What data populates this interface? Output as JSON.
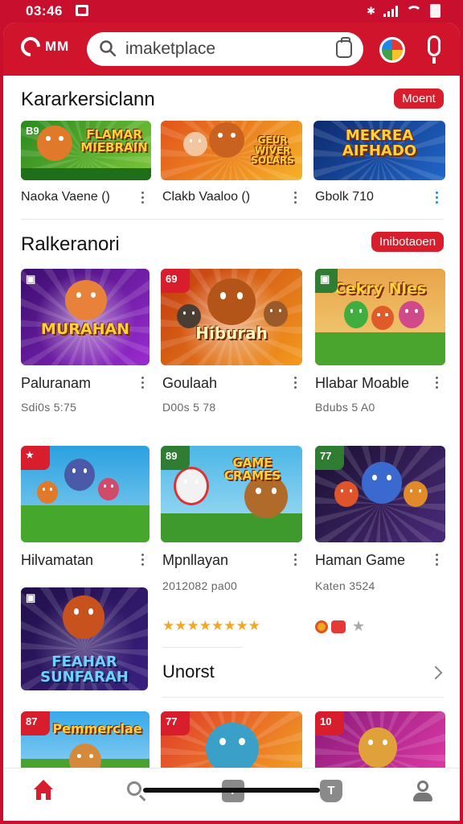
{
  "status_bar": {
    "time": "03:46"
  },
  "header": {
    "brand": "MM",
    "search_placeholder": "imaketplace",
    "colors": {
      "bar": "#d0142c",
      "accent": "#d81d2c"
    }
  },
  "section1": {
    "title": "Kararkersiclann",
    "action": "Moent",
    "games": [
      {
        "name": "Naoka Vaene ()",
        "tile_text": "FLAMAR MIEBRAIN",
        "badge": "B9"
      },
      {
        "name": "Clakb Vaaloo ()",
        "tile_text": "GEUR WIVER SOLARS",
        "badge": ""
      },
      {
        "name": "Gbolk 710",
        "tile_text": "MEKREA AIFHADO",
        "badge": ""
      }
    ]
  },
  "section2": {
    "title": "Ralkeranori",
    "action": "Inibotaoen",
    "games": [
      {
        "name": "Paluranam",
        "sub": "Sdi0s 5:75",
        "tile_text": "MURAHAN",
        "badge": ""
      },
      {
        "name": "Goulaah",
        "sub": "D00s 5 78",
        "tile_text": "Hiburah",
        "badge": "69"
      },
      {
        "name": "Hlabar Moable",
        "sub": "Bdubs 5 A0",
        "tile_text": "Cekry Nles",
        "badge": ""
      },
      {
        "name": "Hilvamatan",
        "sub": "",
        "tile_text": "",
        "badge": ""
      },
      {
        "name": "Mpnllayan",
        "sub": "2012082 pa00",
        "tile_text": "GAME CRAMES",
        "badge": "89"
      },
      {
        "name": "Haman Game",
        "sub": "Katen 3524",
        "tile_text": "",
        "badge": "77"
      }
    ]
  },
  "feature": {
    "tile_text": "FEAHAR SUNFARAH",
    "badge": ""
  },
  "section3": {
    "title": "Unorst"
  },
  "bottom_row": [
    {
      "tile_text": "Pemmerclae",
      "badge": "87"
    },
    {
      "tile_text": "",
      "badge": "77"
    },
    {
      "tile_text": "",
      "badge": "10"
    }
  ],
  "ratings": {
    "stars": "★★★★★★★★"
  },
  "nav": {
    "apps": "r",
    "books": "T"
  }
}
